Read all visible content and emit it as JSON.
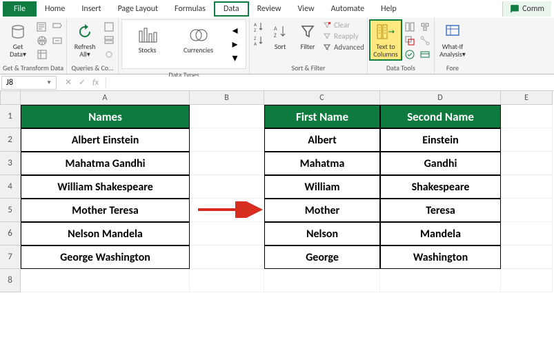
{
  "tabs": {
    "file": "File",
    "home": "Home",
    "insert": "Insert",
    "pagelayout": "Page Layout",
    "formulas": "Formulas",
    "data": "Data",
    "review": "Review",
    "view": "View",
    "automate": "Automate",
    "help": "Help",
    "comments": "Comm"
  },
  "ribbon": {
    "get_data": "Get Data",
    "get_data_sub": "▾",
    "transform_group": "Get & Transform Data",
    "refresh": "Refresh All",
    "refresh_sub": "▾",
    "queries_group": "Queries & Co...",
    "stocks": "Stocks",
    "currencies": "Currencies",
    "types_group": "Data Types",
    "sort": "Sort",
    "filter": "Filter",
    "clear": "Clear",
    "reapply": "Reapply",
    "advanced": "Advanced",
    "sortfilter_group": "Sort & Filter",
    "text_to_columns": "Text to Columns",
    "datatools_group": "Data Tools",
    "whatif": "What-If Analysis",
    "whatif_sub": "▾",
    "forecast_group": "Fore"
  },
  "namebox": "J8",
  "columns": {
    "A_w": 245,
    "B_w": 108,
    "C_w": 168,
    "D_w": 175,
    "E_w": 75
  },
  "sheet": {
    "headers": {
      "names": "Names",
      "first": "First Name",
      "second": "Second Name"
    },
    "rows": [
      {
        "full": "Albert Einstein",
        "first": "Albert",
        "second": "Einstein"
      },
      {
        "full": "Mahatma Gandhi",
        "first": "Mahatma",
        "second": "Gandhi"
      },
      {
        "full": "William Shakespeare",
        "first": "William",
        "second": "Shakespeare"
      },
      {
        "full": "Mother Teresa",
        "first": "Mother",
        "second": "Teresa"
      },
      {
        "full": "Nelson Mandela",
        "first": "Nelson",
        "second": "Mandela"
      },
      {
        "full": "George Washington",
        "first": "George",
        "second": "Washington"
      }
    ]
  }
}
